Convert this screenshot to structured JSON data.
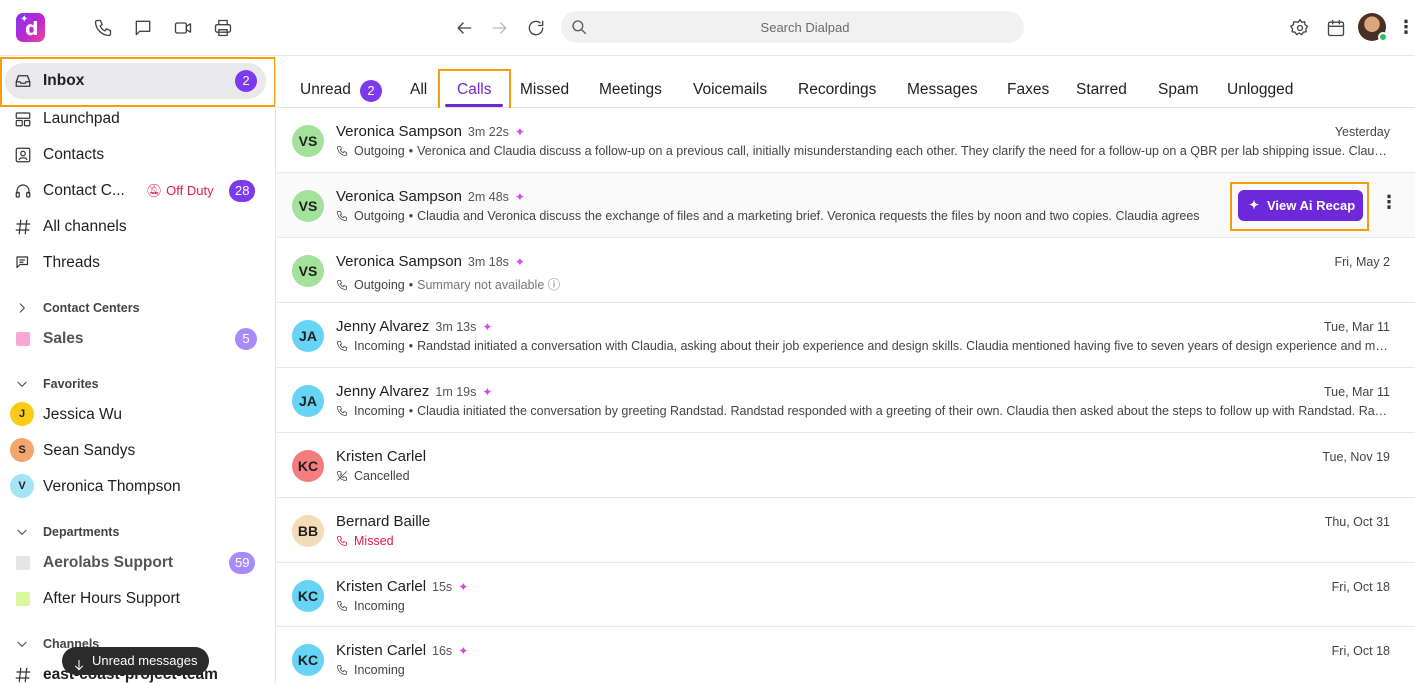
{
  "topbar": {
    "logo_letter": "d",
    "search_placeholder": "Search Dialpad"
  },
  "sidebar": {
    "inbox": {
      "label": "Inbox",
      "badge": "2"
    },
    "launchpad": "Launchpad",
    "contacts": "Contacts",
    "contact_center": {
      "label": "Contact C...",
      "status": "Off Duty",
      "badge": "28"
    },
    "all_channels": "All channels",
    "threads": "Threads",
    "contact_centers_header": "Contact Centers",
    "sales": {
      "label": "Sales",
      "badge": "5",
      "color": "#f9a8d4"
    },
    "favorites_header": "Favorites",
    "favorites": [
      {
        "initial": "J",
        "name": "Jessica Wu",
        "color": "#facc15"
      },
      {
        "initial": "S",
        "name": "Sean Sandys",
        "color": "#f4a56d"
      },
      {
        "initial": "V",
        "name": "Veronica Thompson",
        "color": "#a5e3f6"
      }
    ],
    "departments_header": "Departments",
    "aerolabs": {
      "label": "Aerolabs Support",
      "badge": "59",
      "color": "#e5e5e5"
    },
    "after_hours": {
      "label": "After Hours Support",
      "color": "#d9f99d"
    },
    "channels_header": "Channels",
    "channel_item": "east-coast-project-team",
    "toast": "Unread messages"
  },
  "tabs": {
    "unread": "Unread",
    "unread_badge": "2",
    "all": "All",
    "calls": "Calls",
    "missed": "Missed",
    "meetings": "Meetings",
    "voicemails": "Voicemails",
    "recordings": "Recordings",
    "messages": "Messages",
    "faxes": "Faxes",
    "starred": "Starred",
    "spam": "Spam",
    "unlogged": "Unlogged"
  },
  "rows": [
    {
      "initials": "VS",
      "color": "#a3e29a",
      "name": "Veronica Sampson",
      "duration": "3m 22s",
      "direction": "Outgoing",
      "summary": "Veronica and Claudia discuss a follow-up on a previous call, initially misunderstanding each other. They clarify the need for a follow-up on a QBR per lab shipping issue. Claudia",
      "date": "Yesterday"
    },
    {
      "initials": "VS",
      "color": "#a3e29a",
      "name": "Veronica Sampson",
      "duration": "2m 48s",
      "direction": "Outgoing",
      "summary": "Claudia and Veronica discuss the exchange of files and a marketing brief. Veronica requests the files by noon and two copies. Claudia agrees",
      "date": "",
      "recap": "View Ai Recap"
    },
    {
      "initials": "VS",
      "color": "#a3e29a",
      "name": "Veronica Sampson",
      "duration": "3m 18s",
      "direction": "Outgoing",
      "summary": "Summary not available",
      "date": "Fri, May 2"
    },
    {
      "initials": "JA",
      "color": "#67d3f5",
      "name": "Jenny Alvarez",
      "duration": "3m 13s",
      "direction": "Incoming",
      "summary": "Randstad initiated a conversation with Claudia, asking about their job experience and design skills. Claudia mentioned having five to seven years of design experience and mentioned",
      "date": "Tue, Mar 11"
    },
    {
      "initials": "JA",
      "color": "#67d3f5",
      "name": "Jenny Alvarez",
      "duration": "1m 19s",
      "direction": "Incoming",
      "summary": "Claudia initiated the conversation by greeting Randstad. Randstad responded with a greeting of their own. Claudia then asked about the steps to follow up with Randstad. Randstad",
      "date": "Tue, Mar 11"
    },
    {
      "initials": "KC",
      "color": "#f47c7c",
      "name": "Kristen Carlel",
      "duration": "",
      "direction": "Cancelled",
      "summary": "",
      "date": "Tue, Nov 19"
    },
    {
      "initials": "BB",
      "color": "#f5dcb8",
      "name": "Bernard Baille",
      "duration": "",
      "direction": "Missed",
      "summary": "",
      "date": "Thu, Oct 31"
    },
    {
      "initials": "KC",
      "color": "#67d3f5",
      "name": "Kristen Carlel",
      "duration": "15s",
      "direction": "Incoming",
      "summary": "",
      "date": "Fri, Oct 18"
    },
    {
      "initials": "KC",
      "color": "#67d3f5",
      "name": "Kristen Carlel",
      "duration": "16s",
      "direction": "Incoming",
      "summary": "",
      "date": "Fri, Oct 18"
    }
  ]
}
